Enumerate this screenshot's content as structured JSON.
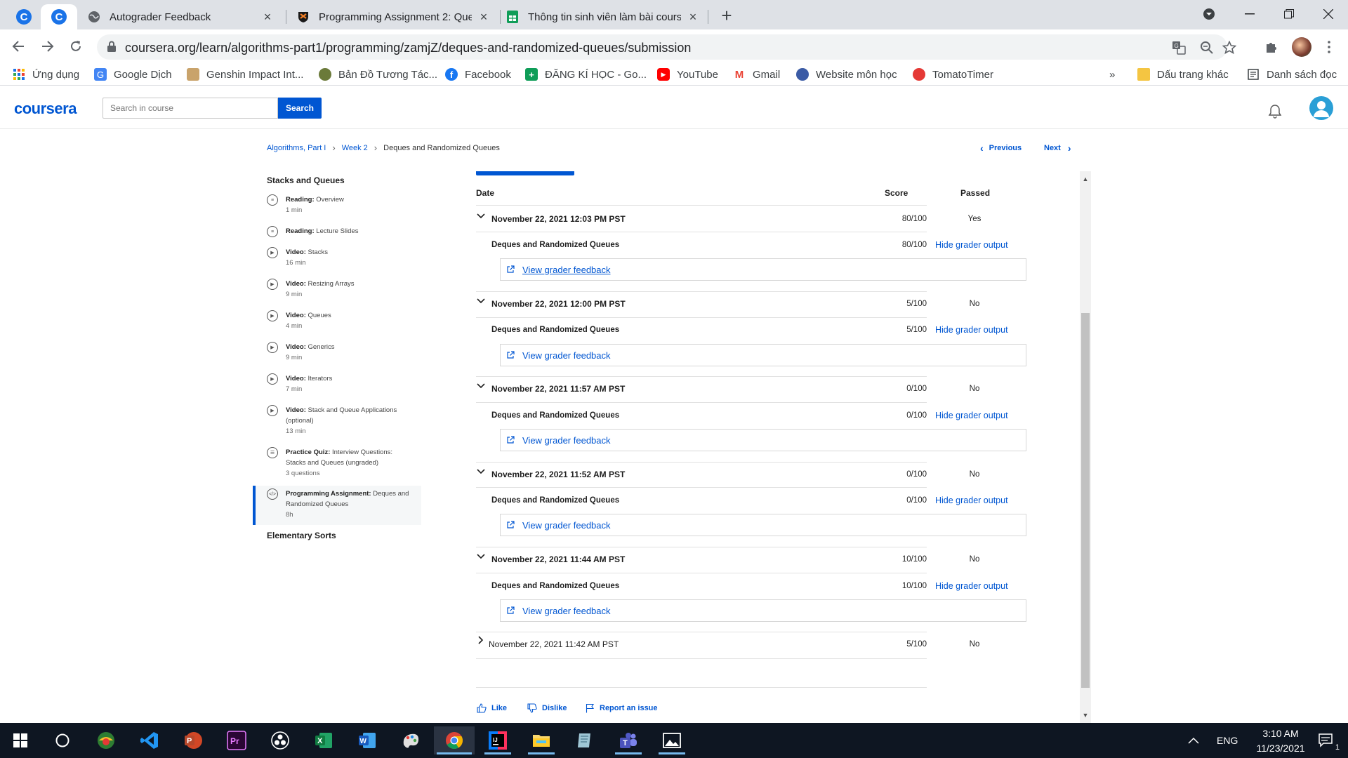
{
  "browser": {
    "tabs": [
      {
        "title": "Autograder Feedback",
        "icon": "globe-icon"
      },
      {
        "title": "Programming Assignment 2: Que",
        "icon": "princeton-shield-icon"
      },
      {
        "title": "Thông tin sinh viên làm bài cours",
        "icon": "sheets-icon"
      }
    ],
    "url": "coursera.org/learn/algorithms-part1/programming/zamjZ/deques-and-randomized-queues/submission",
    "bookmarks": [
      {
        "label": "Ứng dụng",
        "icon": "apps-grid-icon",
        "color": "#1a73e8"
      },
      {
        "label": "Google Dịch",
        "icon": "google-translate-icon",
        "color": "#4285f4"
      },
      {
        "label": "Genshin Impact Int...",
        "icon": "genshin-icon",
        "color": "#8a6d4a"
      },
      {
        "label": "Bản Đồ Tương Tác...",
        "icon": "map-icon",
        "color": "#6b7a3a"
      },
      {
        "label": "Facebook",
        "icon": "facebook-icon",
        "color": "#1877f2"
      },
      {
        "label": "ĐĂNG KÍ HỌC - Go...",
        "icon": "sheets-icon",
        "color": "#0f9d58"
      },
      {
        "label": "YouTube",
        "icon": "youtube-icon",
        "color": "#ff0000"
      },
      {
        "label": "Gmail",
        "icon": "gmail-icon",
        "color": "#ea4335"
      },
      {
        "label": "Website môn học",
        "icon": "website-icon",
        "color": "#3b5ba5"
      },
      {
        "label": "TomatoTimer",
        "icon": "tomato-icon",
        "color": "#e53935"
      }
    ],
    "overflow": "»",
    "other_bookmarks": "Dấu trang khác",
    "reading_list": "Danh sách đọc"
  },
  "coursera": {
    "logo": "coursera",
    "search_placeholder": "Search in course",
    "search_button": "Search"
  },
  "breadcrumb": {
    "items": [
      "Algorithms, Part I",
      "Week 2",
      "Deques and Randomized Queues"
    ],
    "previous": "Previous",
    "next": "Next"
  },
  "sidebar": {
    "section1": "Stacks and Queues",
    "items": [
      {
        "type": "Reading:",
        "title": "Overview",
        "duration": "1 min",
        "icon": "reading-icon"
      },
      {
        "type": "Reading:",
        "title": "Lecture Slides",
        "duration": "",
        "icon": "reading-icon"
      },
      {
        "type": "Video:",
        "title": "Stacks",
        "duration": "16 min",
        "icon": "play-icon"
      },
      {
        "type": "Video:",
        "title": "Resizing Arrays",
        "duration": "9 min",
        "icon": "play-icon"
      },
      {
        "type": "Video:",
        "title": "Queues",
        "duration": "4 min",
        "icon": "play-icon"
      },
      {
        "type": "Video:",
        "title": "Generics",
        "duration": "9 min",
        "icon": "play-icon"
      },
      {
        "type": "Video:",
        "title": "Iterators",
        "duration": "7 min",
        "icon": "play-icon"
      },
      {
        "type": "Video:",
        "title": "Stack and Queue Applications (optional)",
        "duration": "13 min",
        "icon": "play-icon"
      },
      {
        "type": "Practice Quiz:",
        "title": "Interview Questions: Stacks and Queues (ungraded)",
        "duration": "3 questions",
        "icon": "quiz-icon"
      },
      {
        "type": "Programming Assignment:",
        "title": "Deques and Randomized Queues",
        "duration": "8h",
        "icon": "code-icon"
      }
    ],
    "section2": "Elementary Sorts"
  },
  "submissions": {
    "headers": {
      "date": "Date",
      "score": "Score",
      "passed": "Passed"
    },
    "hide_label": "Hide grader output",
    "feedback_label": "View grader feedback",
    "rows": [
      {
        "date": "November 22, 2021 12:03 PM PST",
        "score": "80/100",
        "passed": "Yes",
        "part": "Deques and Randomized Queues",
        "part_score": "80/100"
      },
      {
        "date": "November 22, 2021 12:00 PM PST",
        "score": "5/100",
        "passed": "No",
        "part": "Deques and Randomized Queues",
        "part_score": "5/100"
      },
      {
        "date": "November 22, 2021 11:57 AM PST",
        "score": "0/100",
        "passed": "No",
        "part": "Deques and Randomized Queues",
        "part_score": "0/100"
      },
      {
        "date": "November 22, 2021 11:52 AM PST",
        "score": "0/100",
        "passed": "No",
        "part": "Deques and Randomized Queues",
        "part_score": "0/100"
      },
      {
        "date": "November 22, 2021 11:44 AM PST",
        "score": "10/100",
        "passed": "No",
        "part": "Deques and Randomized Queues",
        "part_score": "10/100"
      }
    ],
    "collapsed_row": {
      "date": "November 22, 2021 11:42 AM PST",
      "score": "5/100",
      "passed": "No"
    }
  },
  "footer": {
    "like": "Like",
    "dislike": "Dislike",
    "report": "Report an issue"
  },
  "taskbar": {
    "language": "ENG",
    "time": "3:10 AM",
    "date": "11/23/2021",
    "notifications": "1"
  },
  "colors": {
    "coursera_blue": "#0056d2",
    "taskbar": "#0e1622"
  }
}
